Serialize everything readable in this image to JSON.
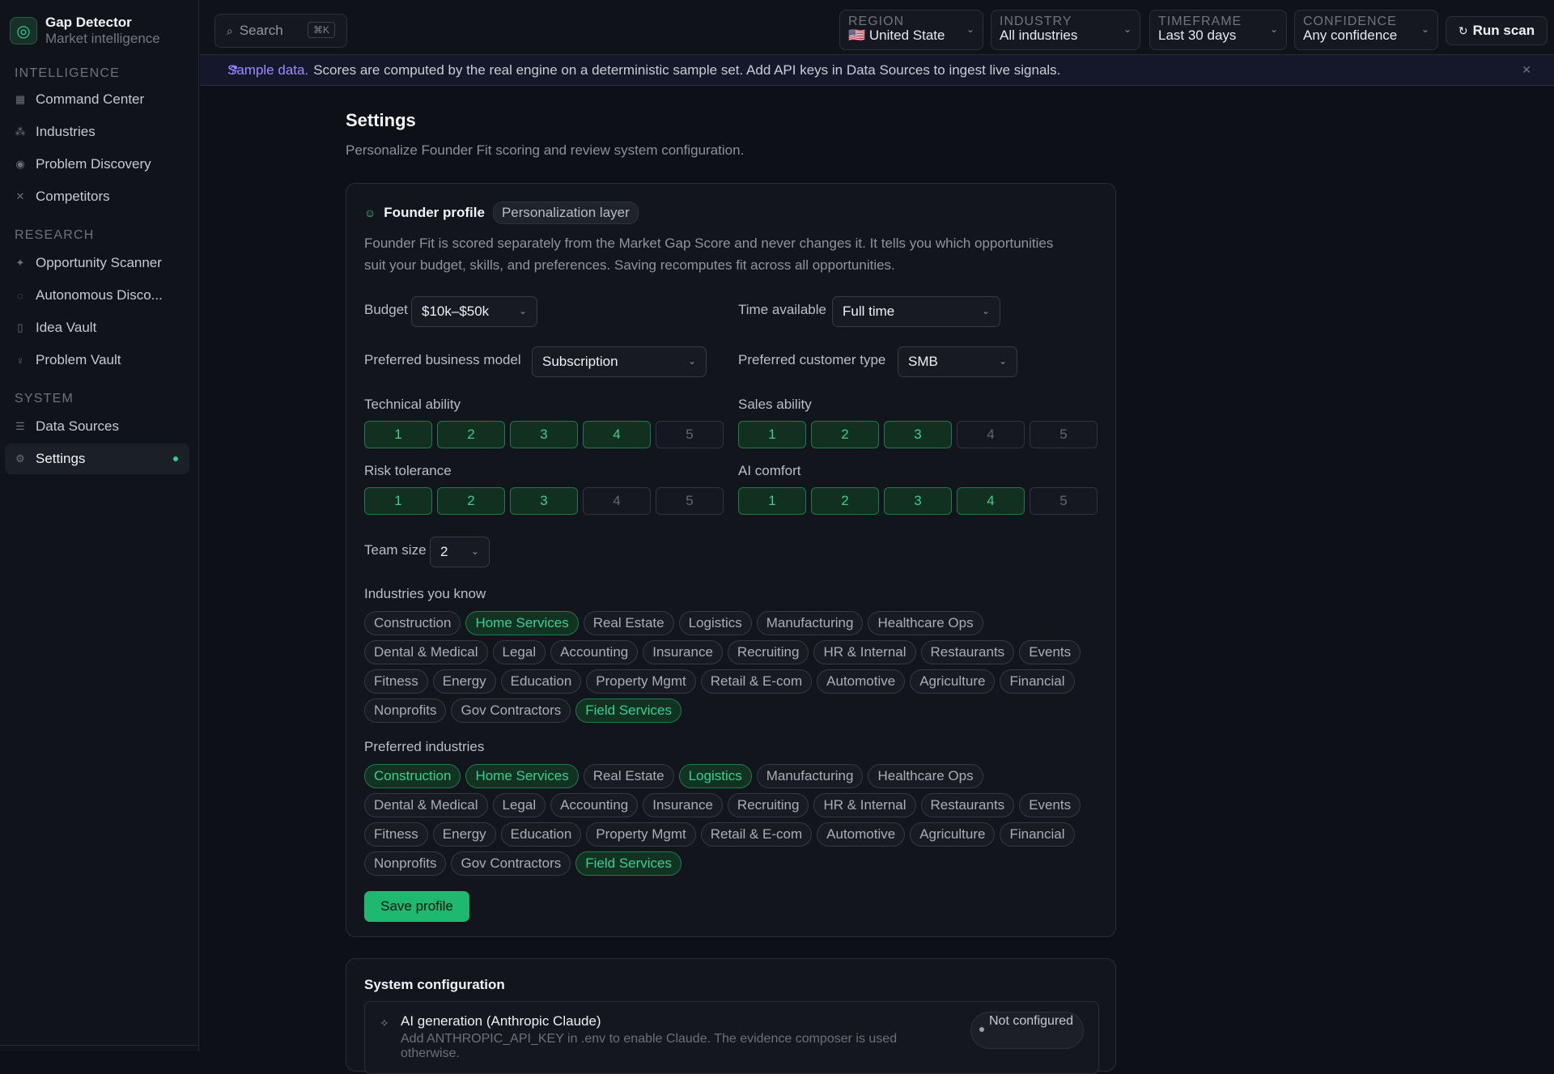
{
  "app": {
    "title": "Gap Detector",
    "subtitle": "Market intelligence",
    "logo_icon": "radar-icon",
    "accent_color": "#2fd08c"
  },
  "sidebar": {
    "sections": [
      {
        "heading": "INTELLIGENCE",
        "items": [
          {
            "label": "Command Center",
            "icon": "grid-icon"
          },
          {
            "label": "Industries",
            "icon": "nodes-icon"
          },
          {
            "label": "Problem Discovery",
            "icon": "broadcast-icon"
          },
          {
            "label": "Competitors",
            "icon": "swords-icon"
          }
        ]
      },
      {
        "heading": "RESEARCH",
        "items": [
          {
            "label": "Opportunity Scanner",
            "icon": "sparkle-icon"
          },
          {
            "label": "Autonomous Disco...",
            "icon": "orbit-icon"
          },
          {
            "label": "Idea Vault",
            "icon": "bookmark-icon"
          },
          {
            "label": "Problem Vault",
            "icon": "bulb-icon"
          }
        ]
      },
      {
        "heading": "SYSTEM",
        "items": [
          {
            "label": "Data Sources",
            "icon": "database-icon"
          },
          {
            "label": "Settings",
            "icon": "gear-icon",
            "active": true
          }
        ]
      }
    ]
  },
  "topbar": {
    "search_label": "Search",
    "search_shortcut": "⌘K",
    "filters": [
      {
        "label": "REGION",
        "value": "🇺🇸 United State"
      },
      {
        "label": "INDUSTRY",
        "value": "All industries"
      },
      {
        "label": "TIMEFRAME",
        "value": "Last 30 days"
      },
      {
        "label": "CONFIDENCE",
        "value": "Any confidence"
      }
    ],
    "run_label": "Run scan"
  },
  "banner": {
    "accent": "Sample data.",
    "text": "Scores are computed by the real engine on a deterministic sample set. Add API keys in Data Sources to ingest live signals.",
    "accent_color": "#9f8bff"
  },
  "page": {
    "title": "Settings",
    "subtitle": "Personalize Founder Fit scoring and review system configuration."
  },
  "founder_profile": {
    "title": "Founder profile",
    "pill": "Personalization layer",
    "description": "Founder Fit is scored separately from the Market Gap Score and never changes it. It tells you which opportunities suit your budget, skills, and preferences. Saving recomputes fit across all opportunities.",
    "budget": {
      "label": "Budget",
      "value": "$10k–$50k"
    },
    "time": {
      "label": "Time available",
      "value": "Full time"
    },
    "model": {
      "label": "Preferred business model",
      "value": "Subscription"
    },
    "customer": {
      "label": "Preferred customer type",
      "value": "SMB"
    },
    "scales": [
      {
        "label": "Technical ability",
        "options": [
          "1",
          "2",
          "3",
          "4",
          "5"
        ],
        "value": 4
      },
      {
        "label": "Sales ability",
        "options": [
          "1",
          "2",
          "3",
          "4",
          "5"
        ],
        "value": 3
      },
      {
        "label": "Risk tolerance",
        "options": [
          "1",
          "2",
          "3",
          "4",
          "5"
        ],
        "value": 3
      },
      {
        "label": "AI comfort",
        "options": [
          "1",
          "2",
          "3",
          "4",
          "5"
        ],
        "value": 4
      }
    ],
    "team": {
      "label": "Team size",
      "value": "2"
    },
    "industries_known": {
      "label": "Industries you know",
      "chips": [
        {
          "label": "Construction"
        },
        {
          "label": "Home Services",
          "on": true
        },
        {
          "label": "Real Estate"
        },
        {
          "label": "Logistics"
        },
        {
          "label": "Manufacturing"
        },
        {
          "label": "Healthcare Ops"
        },
        {
          "label": "Dental & Medical"
        },
        {
          "label": "Legal"
        },
        {
          "label": "Accounting"
        },
        {
          "label": "Insurance"
        },
        {
          "label": "Recruiting"
        },
        {
          "label": "HR & Internal"
        },
        {
          "label": "Restaurants"
        },
        {
          "label": "Events"
        },
        {
          "label": "Fitness"
        },
        {
          "label": "Energy"
        },
        {
          "label": "Education"
        },
        {
          "label": "Property Mgmt"
        },
        {
          "label": "Retail & E-com"
        },
        {
          "label": "Automotive"
        },
        {
          "label": "Agriculture"
        },
        {
          "label": "Financial"
        },
        {
          "label": "Nonprofits"
        },
        {
          "label": "Gov Contractors"
        },
        {
          "label": "Field Services",
          "on": true
        }
      ]
    },
    "industries_preferred": {
      "label": "Preferred industries",
      "chips": [
        {
          "label": "Construction",
          "on": true
        },
        {
          "label": "Home Services",
          "on": true
        },
        {
          "label": "Real Estate"
        },
        {
          "label": "Logistics",
          "on": true
        },
        {
          "label": "Manufacturing"
        },
        {
          "label": "Healthcare Ops"
        },
        {
          "label": "Dental & Medical"
        },
        {
          "label": "Legal"
        },
        {
          "label": "Accounting"
        },
        {
          "label": "Insurance"
        },
        {
          "label": "Recruiting"
        },
        {
          "label": "HR & Internal"
        },
        {
          "label": "Restaurants"
        },
        {
          "label": "Events"
        },
        {
          "label": "Fitness"
        },
        {
          "label": "Energy"
        },
        {
          "label": "Education"
        },
        {
          "label": "Property Mgmt"
        },
        {
          "label": "Retail & E-com"
        },
        {
          "label": "Automotive"
        },
        {
          "label": "Agriculture"
        },
        {
          "label": "Financial"
        },
        {
          "label": "Nonprofits"
        },
        {
          "label": "Gov Contractors"
        },
        {
          "label": "Field Services",
          "on": true
        }
      ]
    },
    "save_label": "Save profile"
  },
  "system": {
    "title": "System configuration",
    "ai": {
      "title": "AI generation (Anthropic Claude)",
      "desc": "Add ANTHROPIC_API_KEY in .env to enable Claude. The evidence composer is used otherwise.",
      "status": "Not configured"
    }
  }
}
